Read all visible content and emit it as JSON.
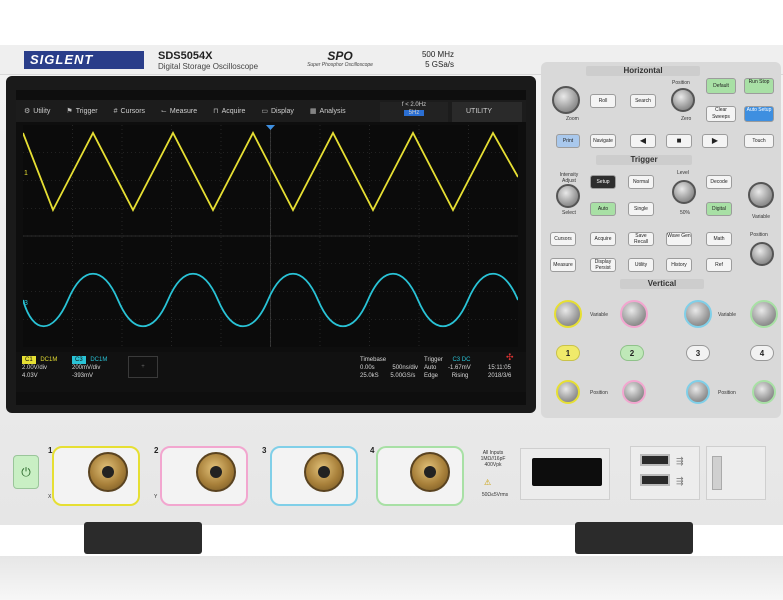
{
  "brand": {
    "logo": "SIGLENT",
    "model": "SDS5054X",
    "subtitle": "Digital Storage Oscilloscope",
    "spo": "SPO",
    "spo_sub": "Super Phosphor Oscilloscope",
    "bandwidth": "500 MHz",
    "sample_rate": "5 GSa/s"
  },
  "menu": [
    {
      "label": "Utility",
      "icon": "gear-icon"
    },
    {
      "label": "Trigger",
      "icon": "flag-icon"
    },
    {
      "label": "Cursors",
      "icon": "cursor-icon"
    },
    {
      "label": "Measure",
      "icon": "measure-icon"
    },
    {
      "label": "Acquire",
      "icon": "acquire-icon"
    },
    {
      "label": "Display",
      "icon": "display-icon"
    },
    {
      "label": "Analysis",
      "icon": "analysis-icon"
    }
  ],
  "freq_counter": {
    "label": "f < 2.0Hz",
    "value": "5Hz"
  },
  "utility_tab": "UTILITY",
  "channels": {
    "c1": {
      "tag": "C1",
      "coupling": "DC1M",
      "scale": "2.00V/div",
      "offset": "4.03V",
      "color": "#e6df33"
    },
    "c3": {
      "tag": "C3",
      "coupling": "DC1M",
      "scale": "200mV/div",
      "offset": "-393mV",
      "color": "#29c3d6"
    }
  },
  "timebase": {
    "label": "Timebase",
    "delay": "0.00s",
    "scale": "500ns/div",
    "memory": "25.0kS",
    "rate": "5.00GS/s"
  },
  "trigger": {
    "label": "Trigger",
    "source": "C3 DC",
    "mode": "Auto",
    "level": "-1.67mV",
    "type": "Edge",
    "slope": "Rising"
  },
  "clock": {
    "time": "15:11:05",
    "date": "2018/3/6"
  },
  "panel": {
    "horizontal": "Horizontal",
    "trigger": "Trigger",
    "vertical": "Vertical",
    "buttons": {
      "roll": "Roll",
      "search": "Search",
      "default": "Default",
      "run_stop": "Run Stop",
      "position": "Position",
      "zoom": "Zoom",
      "zero": "Zero",
      "clear_sweeps": "Clear Sweeps",
      "auto_setup": "Auto Setup",
      "print": "Print",
      "navigate": "Navigate",
      "touch": "Touch",
      "intensity": "Intensity Adjust",
      "select": "Select",
      "setup": "Setup",
      "normal": "Normal",
      "level": "Level",
      "decode": "Decode",
      "auto": "Auto",
      "single": "Single",
      "fifty": "50%",
      "digital": "Digital",
      "variable": "Variable",
      "cursors": "Cursors",
      "acquire": "Acquire",
      "save_recall": "Save Recall",
      "wave_gen": "Wave Gen",
      "math": "Math",
      "measure": "Measure",
      "display_persist": "Display Persist",
      "utility": "Utility",
      "history": "History",
      "ref": "Ref"
    },
    "vertical_channels": [
      "1",
      "2",
      "3",
      "4"
    ]
  },
  "front": {
    "inputs": [
      "1",
      "2",
      "3",
      "4"
    ],
    "x": "X",
    "y": "Y",
    "warning": "All Inputs 1MΩ//16pF 400Vpk",
    "cat": "50Ω≤5Vrms"
  }
}
